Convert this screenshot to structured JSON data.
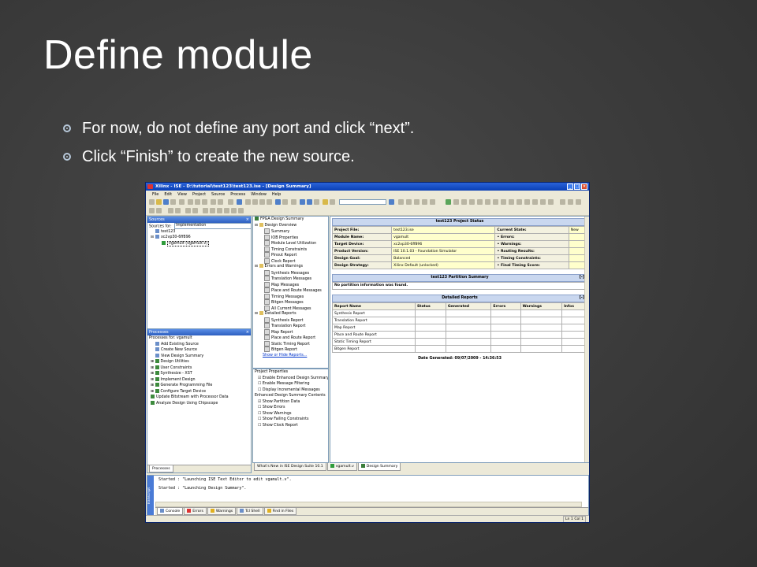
{
  "slide": {
    "title": "Define module",
    "bullets": [
      "For now, do not define any port and click “next”.",
      "Click “Finish” to create the new source."
    ],
    "colors": {
      "background": "#3a3a3a",
      "text": "#ffffff",
      "bullet": "#b7c8d9"
    }
  },
  "window": {
    "title": "Xilinx - ISE - D:\\tutorial\\test123\\test123.ise - [Design Summary]",
    "menu": [
      "File",
      "Edit",
      "View",
      "Project",
      "Source",
      "Process",
      "Window",
      "Help"
    ]
  },
  "sources": {
    "header": "Sources",
    "for_label": "Sources for:",
    "for_value": "Implementation",
    "tree": [
      "test123",
      "xc2vp30-6ff896",
      "vgamult (vgamult.v)"
    ],
    "tabs": [
      "Sources",
      "Files",
      "Snapshots",
      "Libraries"
    ]
  },
  "processes": {
    "header": "Processes",
    "for_label": "Processes for: vgamult",
    "items": [
      "Add Existing Source",
      "Create New Source",
      "View Design Summary",
      "Design Utilities",
      "User Constraints",
      "Synthesize - XST",
      "Implement Design",
      "Generate Programming File",
      "Configure Target Device",
      "Update Bitstream with Processor Data",
      "Analyze Design Using Chipscope"
    ],
    "tab": "Processes"
  },
  "summary_tree": {
    "root": "FPGA Design Summary",
    "groups": [
      {
        "label": "Design Overview",
        "items": [
          "Summary",
          "IOB Properties",
          "Module Level Utilization",
          "Timing Constraints",
          "Pinout Report",
          "Clock Report"
        ]
      },
      {
        "label": "Errors and Warnings",
        "items": [
          "Synthesis Messages",
          "Translation Messages",
          "Map Messages",
          "Place and Route Messages",
          "Timing Messages",
          "Bitgen Messages",
          "All Current Messages"
        ]
      },
      {
        "label": "Detailed Reports",
        "items": [
          "Synthesis Report",
          "Translation Report",
          "Map Report",
          "Place and Route Report",
          "Static Timing Report",
          "Bitgen Report"
        ]
      }
    ],
    "show_hide": "Show or Hide Reports..."
  },
  "project_properties": {
    "header": "Project Properties",
    "items": [
      {
        "label": "Enable Enhanced Design Summary",
        "checked": true
      },
      {
        "label": "Enable Message Filtering",
        "checked": false
      },
      {
        "label": "Display Incremental Messages",
        "checked": false
      }
    ],
    "contents_header": "Enhanced Design Summary Contents",
    "contents": [
      {
        "label": "Show Partition Data",
        "checked": true
      },
      {
        "label": "Show Errors",
        "checked": false
      },
      {
        "label": "Show Warnings",
        "checked": false
      },
      {
        "label": "Show Failing Constraints",
        "checked": false
      },
      {
        "label": "Show Clock Report",
        "checked": false
      }
    ]
  },
  "project_status": {
    "header": "test123 Project Status",
    "rows": [
      [
        "Project File:",
        "test123.ise",
        "Current State:",
        "New"
      ],
      [
        "Module Name:",
        "vgamult",
        "• Errors:",
        ""
      ],
      [
        "Target Device:",
        "xc2vp30-6ff896",
        "• Warnings:",
        ""
      ],
      [
        "Product Version:",
        "ISE 10.1.03 - Foundation Simulator",
        "• Routing Results:",
        ""
      ],
      [
        "Design Goal:",
        "Balanced",
        "• Timing Constraints:",
        ""
      ],
      [
        "Design Strategy:",
        "Xilinx Default (unlocked)",
        "• Final Timing Score:",
        ""
      ]
    ]
  },
  "partition": {
    "header": "test123 Partition Summary",
    "message": "No partition information was found.",
    "toggle": "[-]"
  },
  "detailed_reports": {
    "header": "Detailed Reports",
    "toggle": "[-]",
    "columns": [
      "Report Name",
      "Status",
      "Generated",
      "Errors",
      "Warnings",
      "Infos"
    ],
    "rows": [
      "Synthesis Report",
      "Translation Report",
      "Map Report",
      "Place and Route Report",
      "Static Timing Report",
      "Bitgen Report"
    ],
    "date_generated": "Date Generated: 09/07/2009 - 14:36:53"
  },
  "editor_tabs": [
    "What's New in ISE Design Suite 10.1",
    "vgamult.v",
    "Design Summary"
  ],
  "console": {
    "lines": [
      "Started : \"Launching ISE Text Editor to edit vgamult.v\".",
      "Started : \"Launching Design Summary\"."
    ],
    "tabs": [
      "Console",
      "Errors",
      "Warnings",
      "Tcl Shell",
      "Find in Files"
    ],
    "side_label": "Transcript",
    "status": "Ln 1 Col 1"
  }
}
